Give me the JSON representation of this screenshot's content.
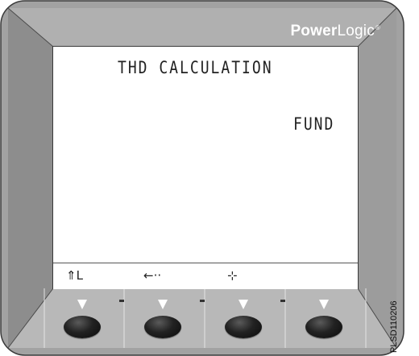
{
  "brand": {
    "bold": "Power",
    "regular": "Logic",
    "mark": "®"
  },
  "screen": {
    "title": "THD CALCULATION",
    "value": "FUND"
  },
  "menu": {
    "icons": [
      {
        "glyph": "⇑L",
        "name": "phase-icon"
      },
      {
        "glyph": "←··",
        "name": "arrow-left-icon"
      },
      {
        "glyph": "⊹",
        "name": "plus-icon"
      }
    ]
  },
  "footer": {
    "code": "PLSD110206"
  },
  "colors": {
    "bezel": "#9a9a9a",
    "panel": "#c4c4c4",
    "lcd": "#ffffff",
    "button": "#1a1a1a"
  }
}
